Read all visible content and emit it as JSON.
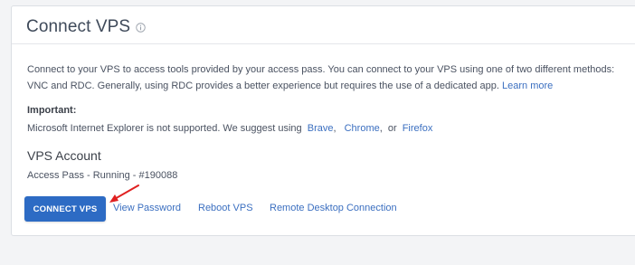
{
  "header": {
    "title": "Connect VPS",
    "info_icon": "info-circle-icon"
  },
  "intro": {
    "text": "Connect to your VPS to access tools provided by your access pass. You can connect to your VPS using one of two different methods: VNC and RDC. Generally, using RDC provides a better experience but requires the use of a dedicated app.",
    "learn_more": "Learn more"
  },
  "important": {
    "label": "Important:",
    "note": "Microsoft Internet Explorer is not supported. We suggest using",
    "browsers": [
      "Brave",
      "Chrome",
      "Firefox"
    ],
    "separator_1": ",",
    "separator_2": ",",
    "or_word": "or"
  },
  "account": {
    "heading": "VPS Account",
    "detail": "Access Pass - Running - #190088"
  },
  "actions": {
    "connect_label": "CONNECT VPS",
    "view_password": "View Password",
    "reboot": "Reboot VPS",
    "remote_desktop": "Remote Desktop Connection"
  },
  "colors": {
    "accent": "#2d6bc4",
    "link": "#3b6fc0",
    "annotation_arrow": "#e02020"
  }
}
